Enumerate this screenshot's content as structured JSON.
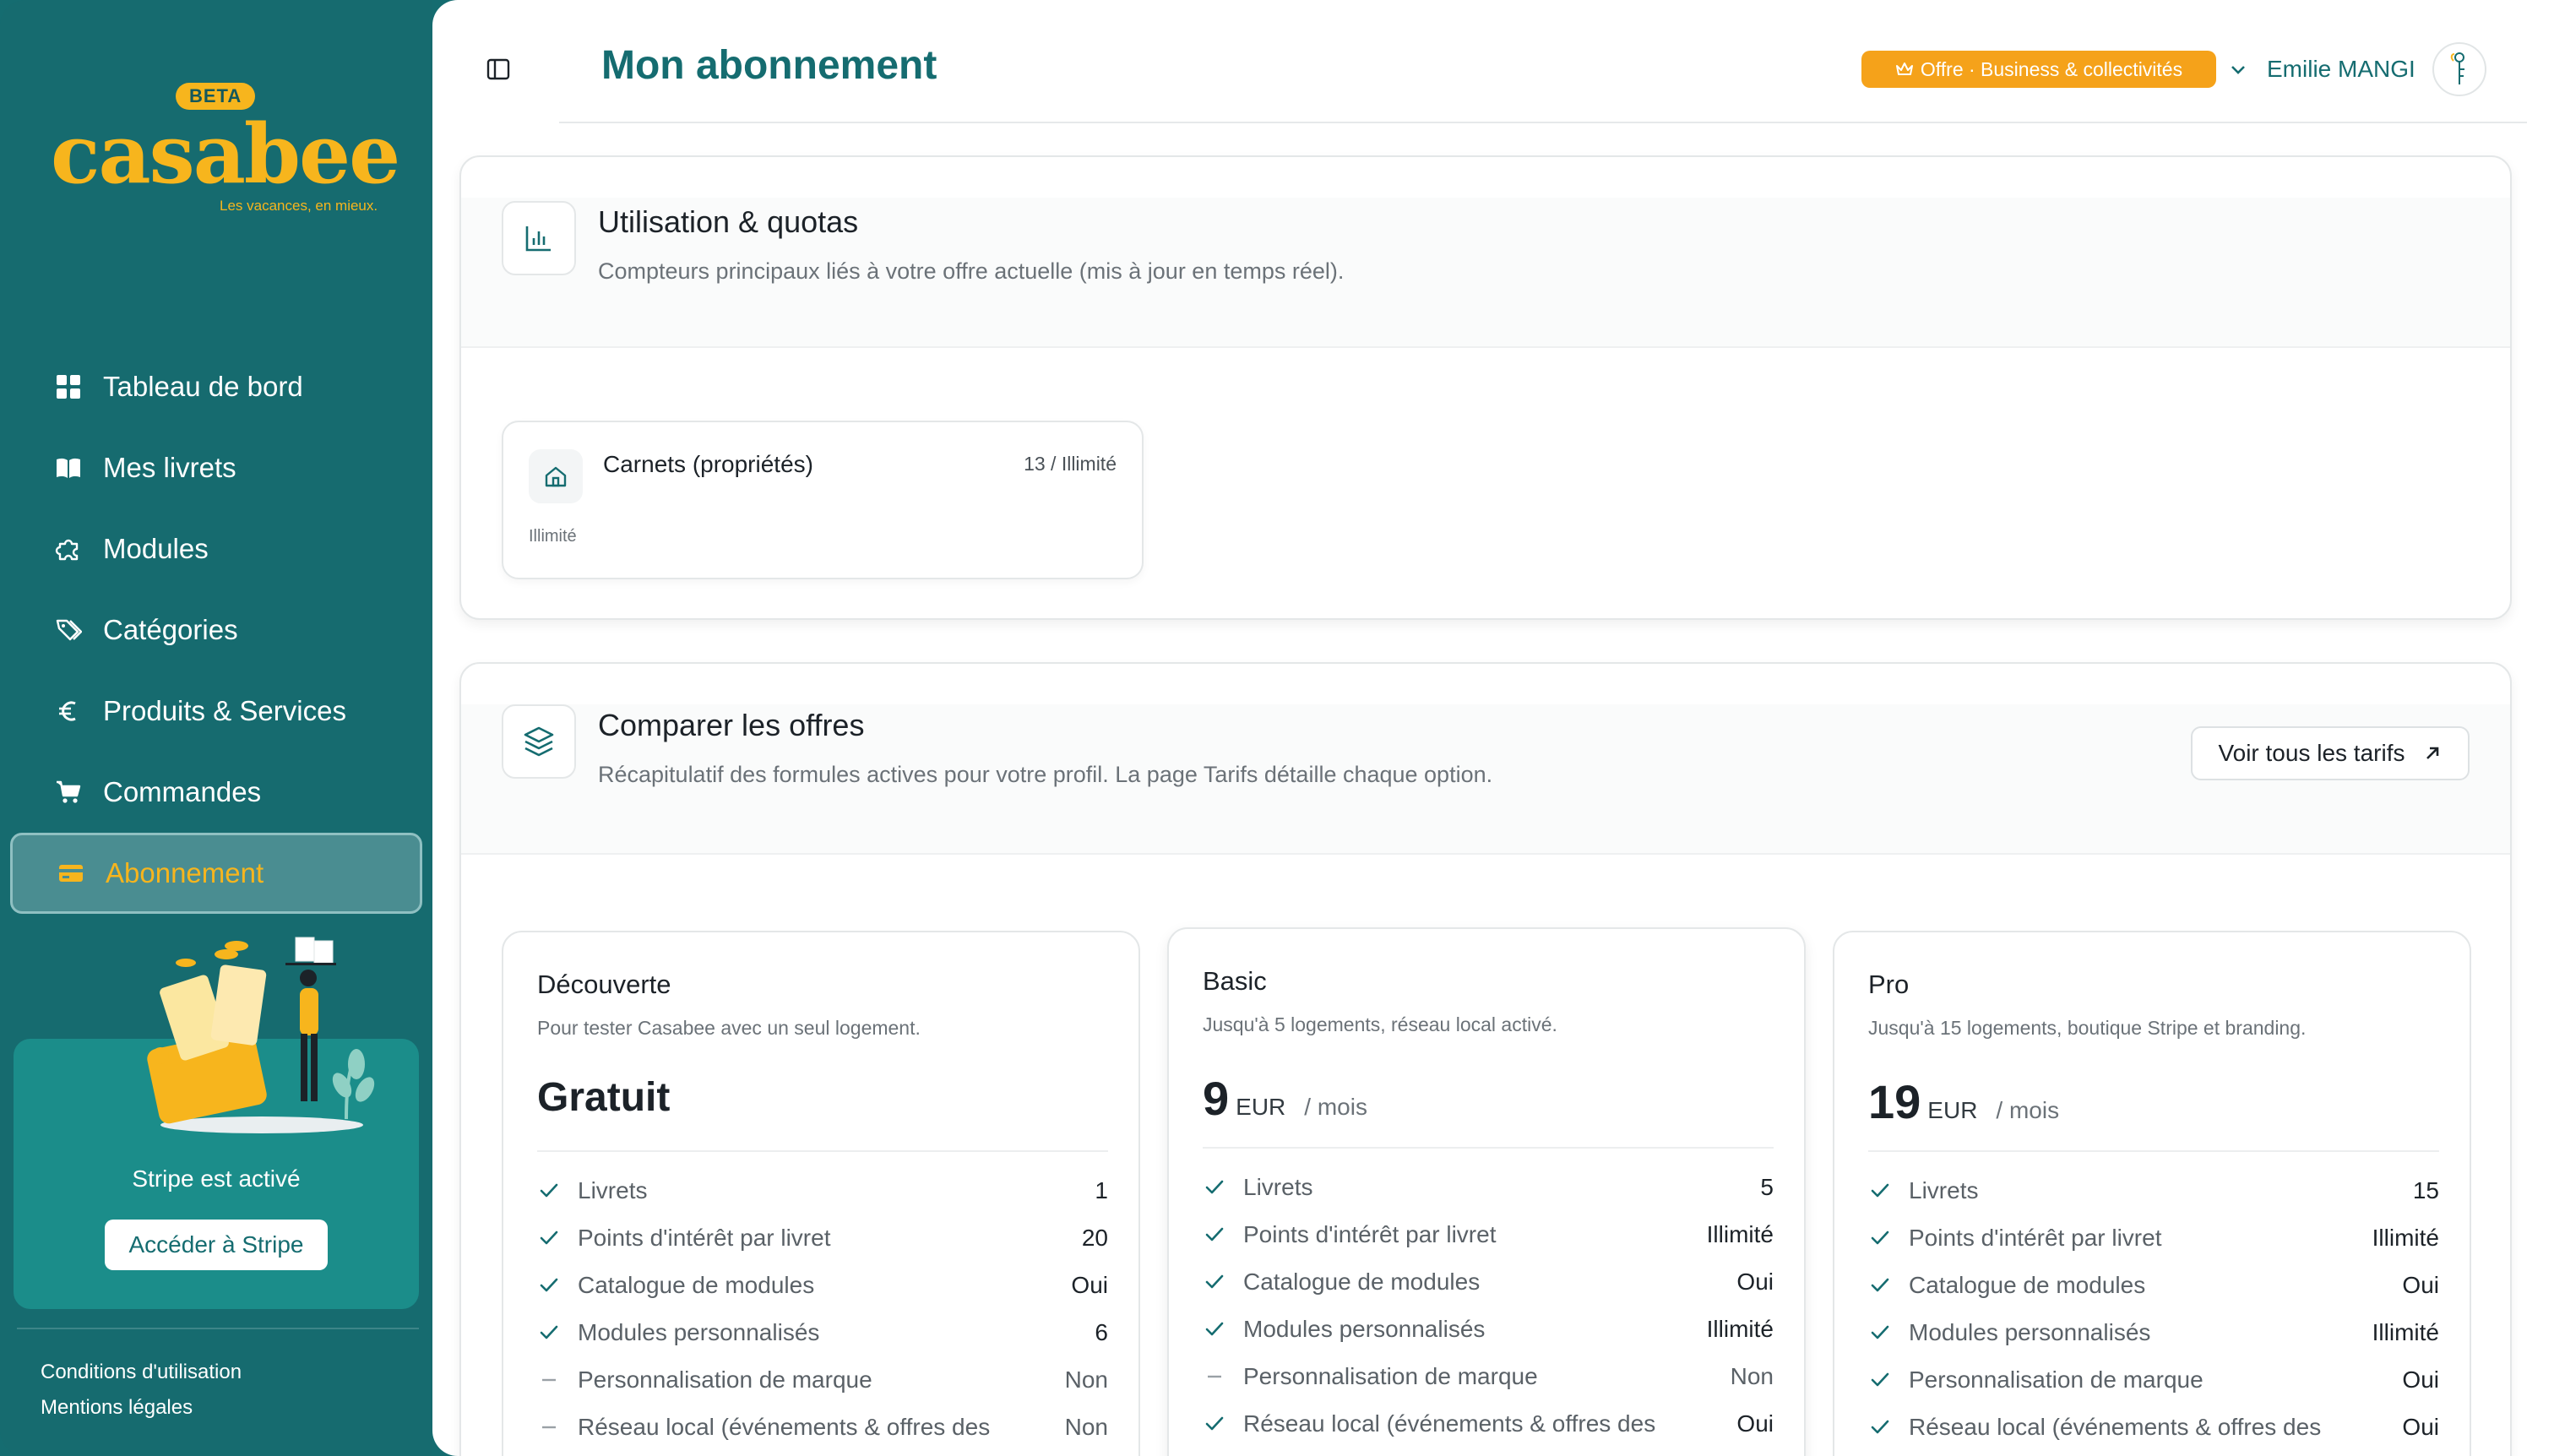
{
  "brand": {
    "badge": "BETA",
    "name": "casabee",
    "tagline": "Les vacances, en mieux.",
    "accent": "#f7b51d",
    "primary": "#156c70"
  },
  "sidebar": {
    "items": [
      {
        "label": "Tableau de bord",
        "icon": "dashboard-grid-icon"
      },
      {
        "label": "Mes livrets",
        "icon": "book-open-icon"
      },
      {
        "label": "Modules",
        "icon": "puzzle-icon"
      },
      {
        "label": "Catégories",
        "icon": "tags-icon"
      },
      {
        "label": "Produits & Services",
        "icon": "euro-icon"
      },
      {
        "label": "Commandes",
        "icon": "shopping-cart-icon"
      },
      {
        "label": "Abonnement",
        "icon": "credit-card-icon",
        "active": true
      }
    ],
    "stripe": {
      "status": "Stripe est activé",
      "button": "Accéder à Stripe"
    },
    "footer": {
      "terms": "Conditions d'utilisation",
      "legal": "Mentions légales"
    }
  },
  "header": {
    "title": "Mon abonnement",
    "plan_badge": "Offre · Business & collectivités",
    "user_name": "Emilie MANGI"
  },
  "usage": {
    "title": "Utilisation & quotas",
    "subtitle": "Compteurs principaux liés à votre offre actuelle (mis à jour en temps réel).",
    "quota": {
      "label": "Carnets (propriétés)",
      "value": "13 / Illimité",
      "footnote": "Illimité"
    }
  },
  "compare": {
    "title": "Comparer les offres",
    "subtitle": "Récapitulatif des formules actives pour votre profil. La page Tarifs détaille chaque option.",
    "button": "Voir tous les tarifs",
    "plans": [
      {
        "name": "Découverte",
        "desc": "Pour tester Casabee avec un seul logement.",
        "price": "Gratuit",
        "currency": "",
        "period": "",
        "features": [
          {
            "label": "Livrets",
            "value": "1",
            "included": true
          },
          {
            "label": "Points d'intérêt par livret",
            "value": "20",
            "included": true
          },
          {
            "label": "Catalogue de modules",
            "value": "Oui",
            "included": true
          },
          {
            "label": "Modules personnalisés",
            "value": "6",
            "included": true
          },
          {
            "label": "Personnalisation de marque",
            "value": "Non",
            "included": false
          },
          {
            "label": "Réseau local (événements & offres des",
            "value": "Non",
            "included": false
          }
        ]
      },
      {
        "name": "Basic",
        "desc": "Jusqu'à 5 logements, réseau local activé.",
        "price": "9",
        "currency": "EUR",
        "period": "/ mois",
        "features": [
          {
            "label": "Livrets",
            "value": "5",
            "included": true
          },
          {
            "label": "Points d'intérêt par livret",
            "value": "Illimité",
            "included": true
          },
          {
            "label": "Catalogue de modules",
            "value": "Oui",
            "included": true
          },
          {
            "label": "Modules personnalisés",
            "value": "Illimité",
            "included": true
          },
          {
            "label": "Personnalisation de marque",
            "value": "Non",
            "included": false
          },
          {
            "label": "Réseau local (événements & offres des",
            "value": "Oui",
            "included": true
          }
        ]
      },
      {
        "name": "Pro",
        "desc": "Jusqu'à 15 logements, boutique Stripe et branding.",
        "price": "19",
        "currency": "EUR",
        "period": "/ mois",
        "features": [
          {
            "label": "Livrets",
            "value": "15",
            "included": true
          },
          {
            "label": "Points d'intérêt par livret",
            "value": "Illimité",
            "included": true
          },
          {
            "label": "Catalogue de modules",
            "value": "Oui",
            "included": true
          },
          {
            "label": "Modules personnalisés",
            "value": "Illimité",
            "included": true
          },
          {
            "label": "Personnalisation de marque",
            "value": "Oui",
            "included": true
          },
          {
            "label": "Réseau local (événements & offres des",
            "value": "Oui",
            "included": true
          }
        ]
      }
    ]
  }
}
